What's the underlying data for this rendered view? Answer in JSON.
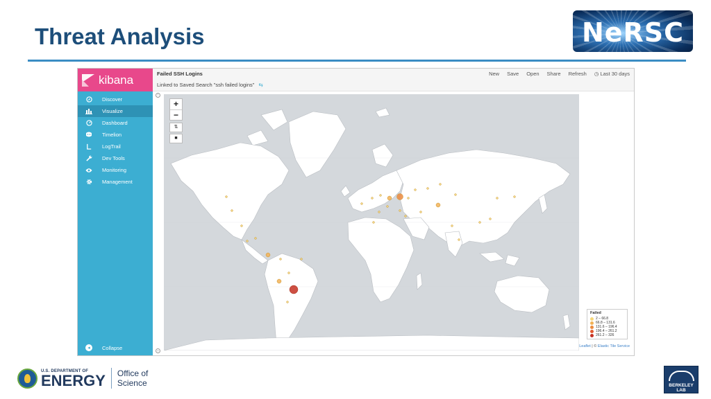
{
  "slide": {
    "title": "Threat Analysis",
    "logo_text": "NeRSC"
  },
  "kibana": {
    "brand": "kibana",
    "nav": [
      {
        "label": "Discover",
        "icon": "compass-icon"
      },
      {
        "label": "Visualize",
        "icon": "bar-chart-icon"
      },
      {
        "label": "Dashboard",
        "icon": "dashboard-icon"
      },
      {
        "label": "Timelion",
        "icon": "timelion-icon"
      },
      {
        "label": "LogTrail",
        "icon": "logtrail-icon"
      },
      {
        "label": "Dev Tools",
        "icon": "wrench-icon"
      },
      {
        "label": "Monitoring",
        "icon": "eye-icon"
      },
      {
        "label": "Management",
        "icon": "gear-icon"
      }
    ],
    "active_nav": "Visualize",
    "collapse_label": "Collapse",
    "vis_title": "Failed SSH Logins",
    "linked_search": "Linked to Saved Search \"ssh failed logins\"",
    "menu": [
      "New",
      "Save",
      "Open",
      "Share",
      "Refresh"
    ],
    "time_range": "Last 30 days",
    "legend": {
      "title": "Failed",
      "ranges": [
        {
          "label": "2 – 66.8",
          "color": "#f5d77a"
        },
        {
          "label": "66.8 – 131.6",
          "color": "#f2b257"
        },
        {
          "label": "131.6 – 196.4",
          "color": "#ec8a3e"
        },
        {
          "label": "196.4 – 261.2",
          "color": "#e35a2f"
        },
        {
          "label": "261.2 – 326",
          "color": "#c43022"
        }
      ]
    },
    "attribution_leaflet": "Leaflet",
    "attribution_sep": " | © ",
    "attribution_tiles": "Elastic Tile Service"
  },
  "footer": {
    "doe_dept": "U.S. DEPARTMENT OF",
    "doe_energy": "ENERGY",
    "office_line1": "Office of",
    "office_line2": "Science",
    "berkeley": "BERKELEY LAB"
  }
}
